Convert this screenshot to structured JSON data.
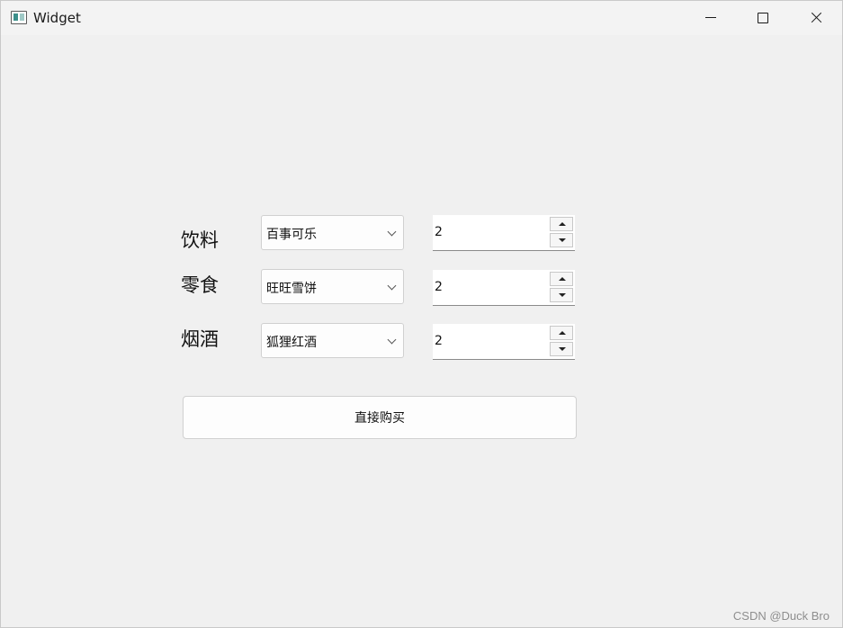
{
  "window": {
    "title": "Widget",
    "icon": "app-window-icon",
    "controls": [
      "minimize-icon",
      "maximize-icon",
      "close-icon"
    ]
  },
  "form": {
    "rows": [
      {
        "label": "饮料",
        "selected": "百事可乐",
        "quantity": "2"
      },
      {
        "label": "零食",
        "selected": "旺旺雪饼",
        "quantity": "2"
      },
      {
        "label": "烟酒",
        "selected": "狐狸红酒",
        "quantity": "2"
      }
    ],
    "buy_button": "直接购买"
  },
  "watermark": "CSDN @Duck Bro"
}
